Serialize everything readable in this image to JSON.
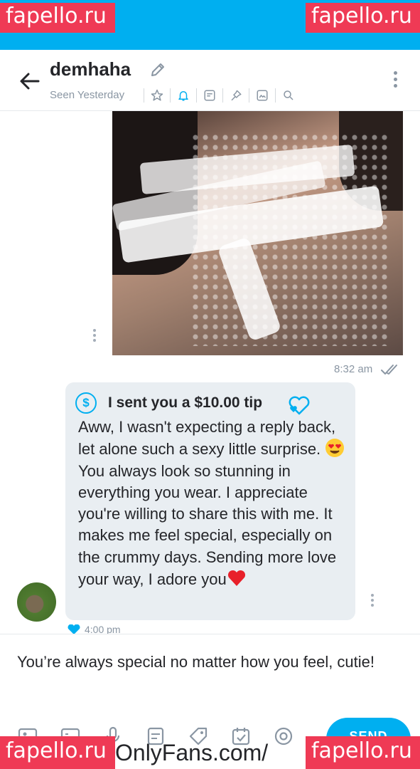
{
  "watermarks": {
    "top_left": "fapello.ru",
    "top_right": "fapello.ru",
    "bottom_left": "fapello.ru",
    "bottom_right": "fapello.ru"
  },
  "header": {
    "username": "demhaha",
    "status": "Seen Yesterday",
    "icons": [
      "star-icon",
      "bell-icon",
      "note-icon",
      "pin-icon",
      "media-icon",
      "search-icon"
    ]
  },
  "chat": {
    "photo_message": {
      "time": "8:32 am"
    },
    "tip_message": {
      "tip_label": "I sent you a $10.00 tip",
      "text_1": "Aww, I wasn't expecting a reply back, let alone such a sexy little surprise. ",
      "text_2": " You always look so stunning in everything you wear. I appreciate you're willing to share this with me. It makes me feel special, especially on the crummy days. Sending more love your way, I adore you",
      "time": "4:00 pm"
    }
  },
  "compose": {
    "text": "You’re always special no matter how you feel, cutie!",
    "send_label": "SEND",
    "footer_url": "OnlyFans.com/"
  },
  "colors": {
    "accent": "#00aff0",
    "watermark": "#ef3a55",
    "bubble": "#e9eef2",
    "muted": "#8a96a3"
  }
}
